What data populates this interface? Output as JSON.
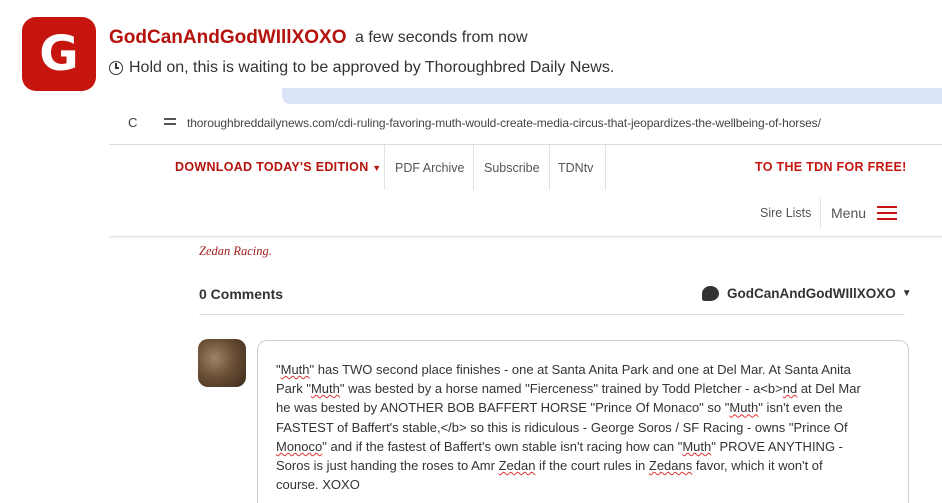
{
  "notification": {
    "avatar_letter": "G",
    "username": "GodCanAndGodWIllXOXO",
    "time": "a few seconds from now",
    "pending_text": "Hold on, this is waiting to be approved by Thoroughbred Daily News."
  },
  "browser": {
    "url": "thoroughbreddailynews.com/cdi-ruling-favoring-muth-would-create-media-circus-that-jeopardizes-the-wellbeing-of-horses/"
  },
  "site_nav": {
    "download_label": "DOWNLOAD TODAY'S EDITION",
    "pdf_archive": "PDF Archive",
    "subscribe": "Subscribe",
    "tdntv": "TDNtv",
    "free_label": "TO THE TDN FOR FREE!",
    "sire_lists": "Sire Lists",
    "menu": "Menu"
  },
  "article": {
    "credit": "Zedan Racing."
  },
  "comments": {
    "count_label": "0 Comments",
    "user": "GodCanAndGodWIllXOXO",
    "draft": {
      "l1a": "\"",
      "l1b": "Muth",
      "l1c": "\" has TWO second place finishes - one  at Santa Anita Park and one at Del Mar.   At Santa Anita",
      "l2a": "Park \"",
      "l2b": "Muth",
      "l2c": "\" was bested by a horse named \"Fierceness\" trained by Todd Pletcher - a<b>",
      "l2d": "nd",
      "l2e": " at Del Mar",
      "l3": "he was bested by ANOTHER BOB BAFFERT HORSE \"Prince Of Monaco\" so \"",
      "l3b": "Muth",
      "l3c": "\" isn't even the",
      "l4": "FASTEST of Baffert's stable,</b> so this is ridiculous - George Soros / SF Racing - owns \"Prince Of",
      "l5a": "Monoco",
      "l5b": "\" and if the fastest of Baffert's own stable isn't racing how can \"",
      "l5c": "Muth",
      "l5d": "\" PROVE ANYTHING -",
      "l6a": "Soros is just handing the roses to Amr ",
      "l6b": "Zedan",
      "l6c": " if the court rules in ",
      "l6d": "Zedans",
      "l6e": " favor, which it won't of",
      "l7": "course. XOXO"
    }
  },
  "colors": {
    "brand_red": "#c5150e"
  }
}
